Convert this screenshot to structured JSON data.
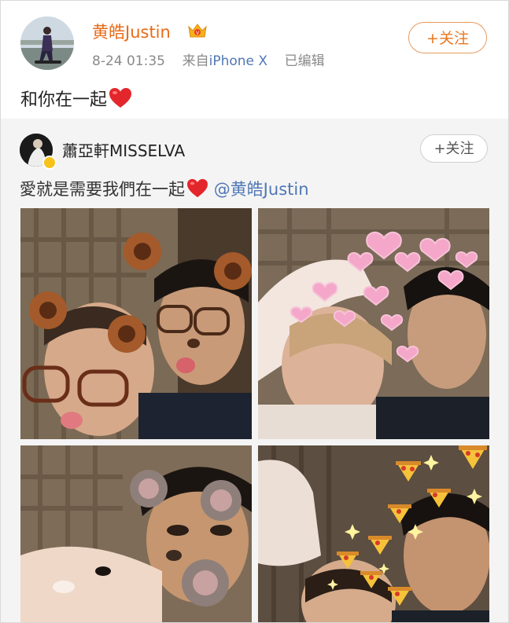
{
  "post": {
    "author": "黄皓Justin",
    "time": "8-24 01:35",
    "source_prefix": "来自",
    "source": "iPhone X",
    "edited": "已编辑",
    "follow_label": "+关注",
    "text": "和你在一起"
  },
  "repost": {
    "author": "蕭亞軒MISSELVA",
    "follow_label": "+关注",
    "text": "愛就是需要我們在一起",
    "mention": "@黄皓Justin"
  },
  "colors": {
    "author_orange": "#e86b17",
    "link_blue": "#4f77b5",
    "repost_bg": "#f4f4f4",
    "follow_border": "#e89a5e"
  },
  "icons": [
    "vip-crown-icon",
    "red-heart-icon",
    "verified-badge-icon"
  ]
}
